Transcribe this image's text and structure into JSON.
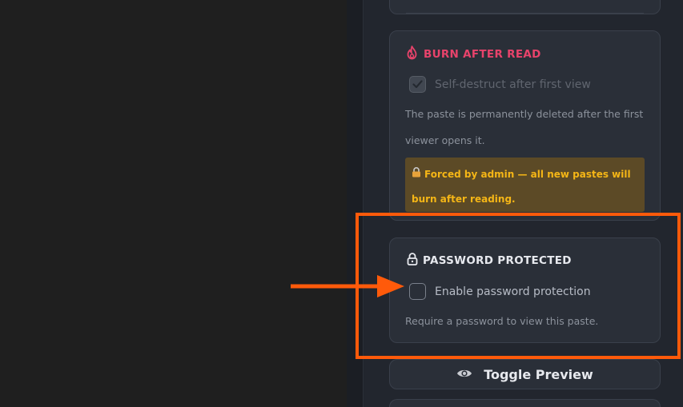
{
  "burn_section": {
    "title": "BURN AFTER READ",
    "checkbox_label": "Self-destruct after first view",
    "checkbox_checked": true,
    "checkbox_disabled": true,
    "description": "The paste is permanently deleted after the first viewer opens it.",
    "warning": "Forced by admin — all new pastes will burn after reading.",
    "icon": "fire-icon",
    "accent_color": "#e8436b",
    "warning_color": "#f5b616"
  },
  "password_section": {
    "title": "PASSWORD PROTECTED",
    "checkbox_label": "Enable password protection",
    "checkbox_checked": false,
    "description": "Require a password to view this paste.",
    "icon": "lock-icon"
  },
  "preview_button": {
    "label": "Toggle Preview",
    "icon": "eye-icon"
  },
  "annotation": {
    "highlight_color": "#ff5a0a"
  }
}
